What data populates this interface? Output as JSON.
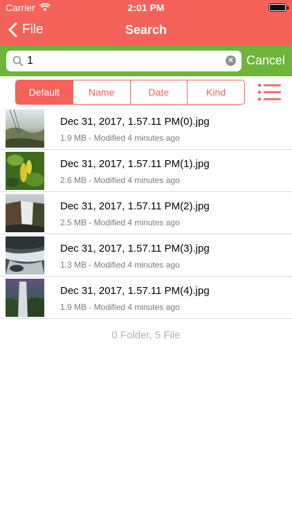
{
  "status_bar": {
    "carrier": "Carrier",
    "time": "2:01 PM",
    "icons": [
      "wifi-icon",
      "battery-icon"
    ]
  },
  "nav": {
    "back_label": "File",
    "title": "Search"
  },
  "search": {
    "value": "1",
    "cancel_label": "Cancel"
  },
  "sort": {
    "options": [
      "Default",
      "Name",
      "Date",
      "Kind"
    ],
    "selected": "Default"
  },
  "files": [
    {
      "name": "Dec 31, 2017, 1.57.11 PM(0).jpg",
      "meta": "1.9 MB - Modified 4 minutes ago"
    },
    {
      "name": "Dec 31, 2017, 1.57.11 PM(1).jpg",
      "meta": "2.6 MB - Modified 4 minutes ago"
    },
    {
      "name": "Dec 31, 2017, 1.57.11 PM(2).jpg",
      "meta": "2.5 MB - Modified 4 minutes ago"
    },
    {
      "name": "Dec 31, 2017, 1.57.11 PM(3).jpg",
      "meta": "1.3 MB - Modified 4 minutes ago"
    },
    {
      "name": "Dec 31, 2017, 1.57.11 PM(4).jpg",
      "meta": "1.9 MB - Modified 4 minutes ago"
    }
  ],
  "summary": "0 Folder, 5 File",
  "colors": {
    "header": "#f5625a",
    "search_bar": "#6eb43a",
    "accent": "#f5625a"
  }
}
